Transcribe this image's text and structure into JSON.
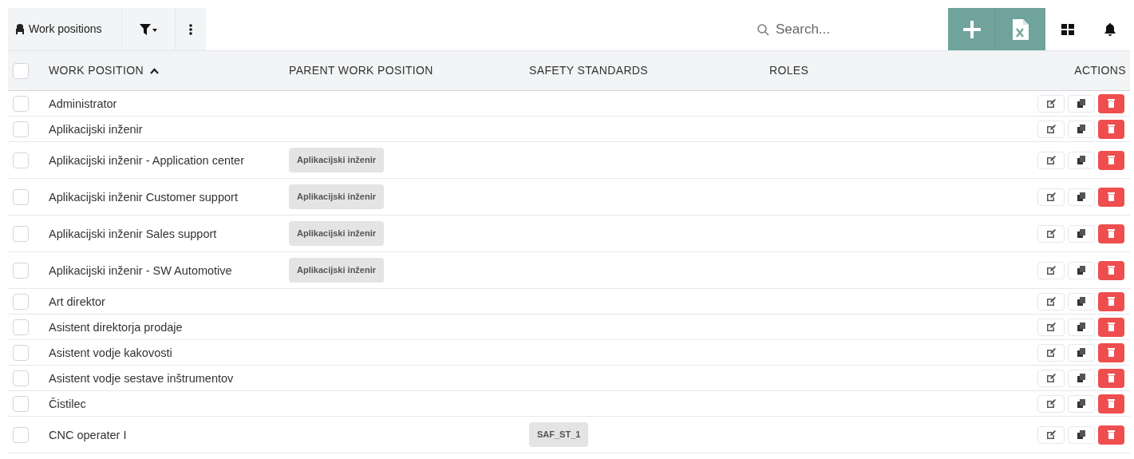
{
  "toolbar": {
    "title": "Work positions",
    "search": {
      "placeholder": "Search..."
    }
  },
  "table": {
    "columns": [
      {
        "label": "WORK POSITION",
        "sorted": true
      },
      {
        "label": "PARENT WORK POSITION",
        "sorted": false
      },
      {
        "label": "SAFETY STANDARDS",
        "sorted": false
      },
      {
        "label": "ROLES",
        "sorted": false
      },
      {
        "label": "ACTIONS",
        "sorted": false
      }
    ],
    "select_all_checked": false,
    "rows": [
      {
        "name": "Administrator",
        "checked": false,
        "parent": [],
        "safety": []
      },
      {
        "name": "Aplikacijski inženir",
        "checked": false,
        "parent": [],
        "safety": []
      },
      {
        "name": "Aplikacijski inženir - Application center",
        "checked": false,
        "parent": [
          "Aplikacijski inženir"
        ],
        "safety": []
      },
      {
        "name": "Aplikacijski inženir Customer support",
        "checked": false,
        "parent": [
          "Aplikacijski inženir"
        ],
        "safety": []
      },
      {
        "name": "Aplikacijski inženir Sales support",
        "checked": false,
        "parent": [
          "Aplikacijski inženir"
        ],
        "safety": []
      },
      {
        "name": "Aplikacijski inženir - SW Automotive",
        "checked": false,
        "parent": [
          "Aplikacijski inženir"
        ],
        "safety": []
      },
      {
        "name": "Art direktor",
        "checked": false,
        "parent": [],
        "safety": []
      },
      {
        "name": "Asistent direktorja prodaje",
        "checked": false,
        "parent": [],
        "safety": []
      },
      {
        "name": "Asistent vodje kakovosti",
        "checked": false,
        "parent": [],
        "safety": []
      },
      {
        "name": "Asistent vodje sestave inštrumentov",
        "checked": false,
        "parent": [],
        "safety": []
      },
      {
        "name": "Čistilec",
        "checked": false,
        "parent": [],
        "safety": []
      },
      {
        "name": "CNC operater I",
        "checked": false,
        "parent": [],
        "safety": [
          "SAF_ST_1"
        ]
      }
    ]
  }
}
